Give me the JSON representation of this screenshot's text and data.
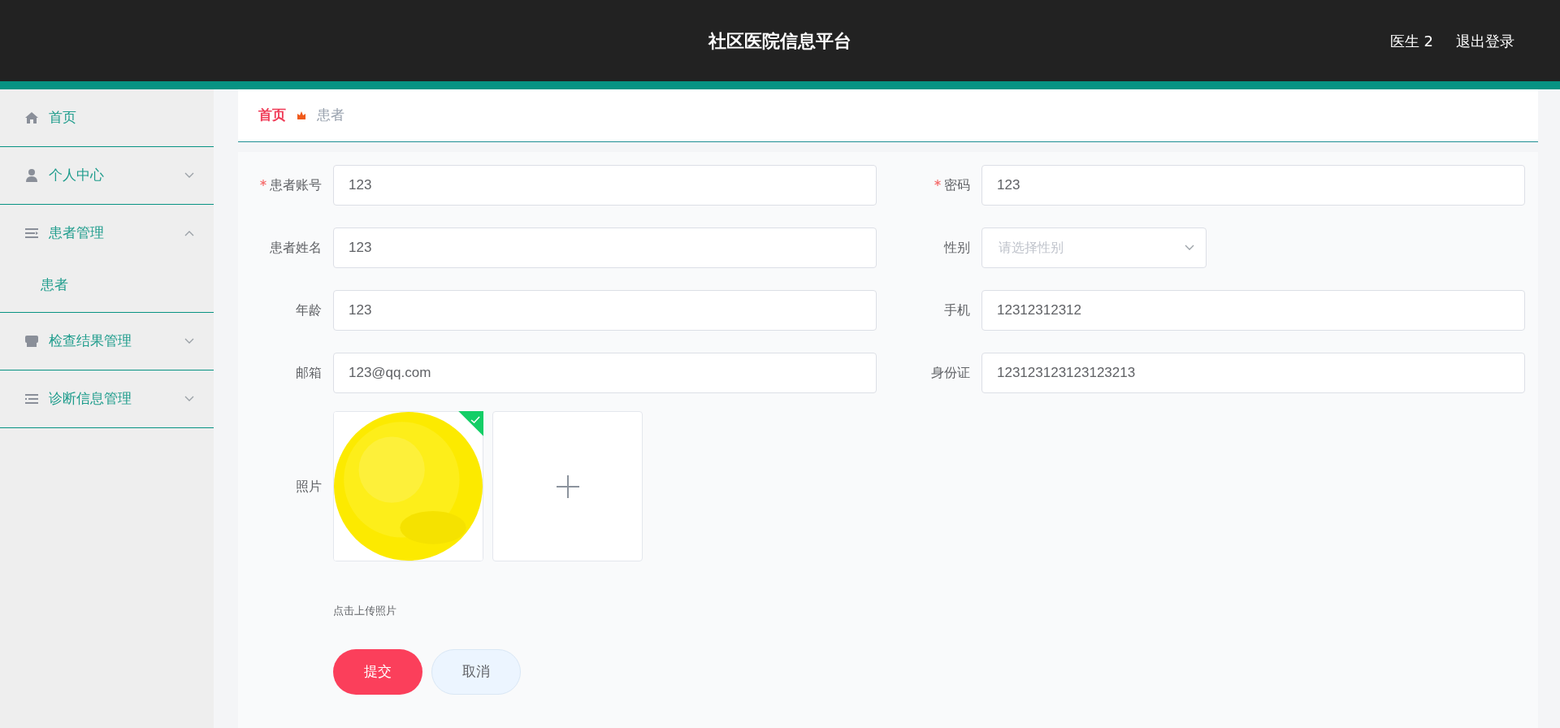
{
  "header": {
    "title": "社区医院信息平台",
    "user": "医生 2",
    "logout": "退出登录"
  },
  "sidebar": {
    "items": [
      {
        "label": "首页",
        "has_arrow": false
      },
      {
        "label": "个人中心",
        "expanded": false,
        "has_arrow": true
      },
      {
        "label": "患者管理",
        "expanded": true,
        "has_arrow": true,
        "children": [
          {
            "label": "患者"
          }
        ]
      },
      {
        "label": "检查结果管理",
        "expanded": false,
        "has_arrow": true
      },
      {
        "label": "诊断信息管理",
        "expanded": false,
        "has_arrow": true
      }
    ]
  },
  "breadcrumb": {
    "home": "首页",
    "current": "患者"
  },
  "form": {
    "fields": [
      {
        "label": "患者账号",
        "required": true,
        "kind": "input",
        "value": "123"
      },
      {
        "label": "密码",
        "required": true,
        "kind": "input",
        "value": "123"
      },
      {
        "label": "患者姓名",
        "required": false,
        "kind": "input",
        "value": "123"
      },
      {
        "label": "性别",
        "required": false,
        "kind": "select",
        "placeholder": "请选择性别"
      },
      {
        "label": "年龄",
        "required": false,
        "kind": "input",
        "value": "123"
      },
      {
        "label": "手机",
        "required": false,
        "kind": "input",
        "value": "12312312312"
      },
      {
        "label": "邮箱",
        "required": false,
        "kind": "input",
        "value": "123@qq.com"
      },
      {
        "label": "身份证",
        "required": false,
        "kind": "input",
        "value": "123123123123123213"
      }
    ],
    "photo": {
      "label": "照片",
      "uploaded": true,
      "hint": "点击上传照片"
    },
    "buttons": [
      {
        "label": "提交",
        "kind": "primary"
      },
      {
        "label": "取消",
        "kind": "secondary"
      }
    ]
  }
}
